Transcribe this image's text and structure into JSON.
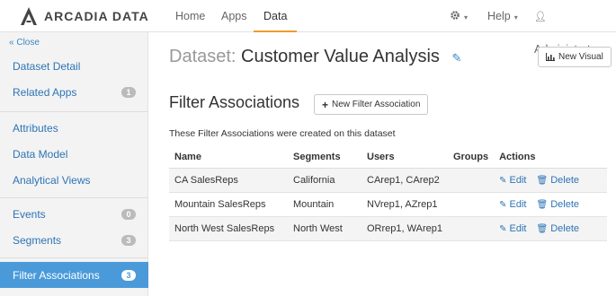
{
  "brand": {
    "name": "ARCADIA DATA",
    "accent": "#f29a2e",
    "link": "#2d74b5"
  },
  "nav": {
    "items": [
      {
        "label": "Home"
      },
      {
        "label": "Apps"
      },
      {
        "label": "Data"
      }
    ],
    "settings_icon": "gear-icon",
    "help": "Help",
    "user": "Administrator",
    "user_icon": "user-icon"
  },
  "sidebar": {
    "close": "Close",
    "items": [
      {
        "label": "Dataset Detail",
        "badge": null
      },
      {
        "label": "Related Apps",
        "badge": "1"
      },
      {
        "label": "Attributes",
        "badge": null
      },
      {
        "label": "Data Model",
        "badge": null
      },
      {
        "label": "Analytical Views",
        "badge": null
      },
      {
        "label": "Events",
        "badge": "0"
      },
      {
        "label": "Segments",
        "badge": "3"
      },
      {
        "label": "Filter Associations",
        "badge": "3"
      }
    ]
  },
  "main": {
    "dataset_prefix": "Dataset:",
    "dataset_name": "Customer Value Analysis",
    "new_visual": "New Visual",
    "section_title": "Filter Associations",
    "new_filter_button": "New Filter Association",
    "description": "These Filter Associations were created on this dataset",
    "table": {
      "headers": [
        "Name",
        "Segments",
        "Users",
        "Groups",
        "Actions"
      ],
      "rows": [
        {
          "name": "CA SalesReps",
          "segments": "California",
          "users": "CArep1, CArep2",
          "groups": ""
        },
        {
          "name": "Mountain SalesReps",
          "segments": "Mountain",
          "users": "NVrep1, AZrep1",
          "groups": ""
        },
        {
          "name": "North West SalesReps",
          "segments": "North West",
          "users": "ORrep1, WArep1",
          "groups": ""
        }
      ],
      "edit_label": "Edit",
      "delete_label": "Delete"
    }
  }
}
